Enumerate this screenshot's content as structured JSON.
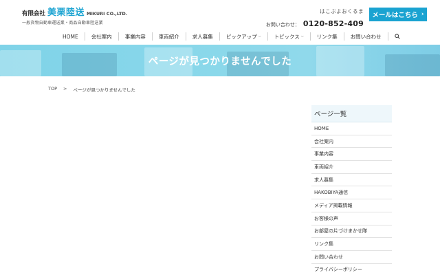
{
  "header": {
    "logo_prefix": "有限会社",
    "logo_name": "美栗陸送",
    "logo_en": "MIKURI CO.,LTD.",
    "logo_sub": "一般貨物自動車運送業・商品自動車陸送業",
    "contact_tagline": "はこぶよおくるま",
    "contact_label": "お問い合わせ：",
    "contact_phone": "0120-852-409",
    "mail_button": "メールはこちら"
  },
  "nav": {
    "items": [
      {
        "label": "HOME"
      },
      {
        "label": "会社案内"
      },
      {
        "label": "事業内容"
      },
      {
        "label": "車両紹介"
      },
      {
        "label": "求人募集"
      },
      {
        "label": "ピックアップ",
        "dropdown": true
      },
      {
        "label": "トピックス",
        "dropdown": true
      },
      {
        "label": "リンク集"
      },
      {
        "label": "お問い合わせ"
      }
    ]
  },
  "banner": {
    "title": "ページが見つかりませんでした"
  },
  "breadcrumb": {
    "home": "TOP",
    "separator": ">",
    "current": "ページが見つかりませんでした"
  },
  "sidebar": {
    "heading": "ページ一覧",
    "items": [
      "HOME",
      "会社案内",
      "事業内容",
      "車両紹介",
      "求人募集",
      "HAKOBIYA通信",
      "メディア掲載情報",
      "お客様の声",
      "お部屋の片づけまかせ隊",
      "リンク集",
      "お問い合わせ",
      "プライバシーポリシー"
    ]
  },
  "colors": {
    "accent": "#1aa3d1",
    "banner": "#88d7ea",
    "sidebar_head": "#eef7fb"
  }
}
